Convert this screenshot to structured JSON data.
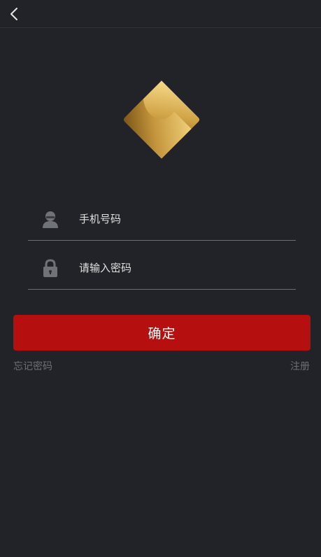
{
  "header": {
    "back_icon": "chevron-left-icon"
  },
  "logo": {
    "icon": "gold-pinwheel-logo",
    "colors": [
      "#f3d27a",
      "#c99a3a",
      "#7a5416"
    ]
  },
  "form": {
    "phone": {
      "icon": "user-icon",
      "placeholder": "手机号码",
      "value": ""
    },
    "password": {
      "icon": "lock-icon",
      "placeholder": "请输入密码",
      "value": ""
    },
    "confirm_label": "确定"
  },
  "links": {
    "forgot_password": "忘记密码",
    "register": "注册"
  },
  "colors": {
    "background": "#212328",
    "accent": "#b50f10",
    "divider": "#6b6e73",
    "muted_text": "#6d7075"
  }
}
